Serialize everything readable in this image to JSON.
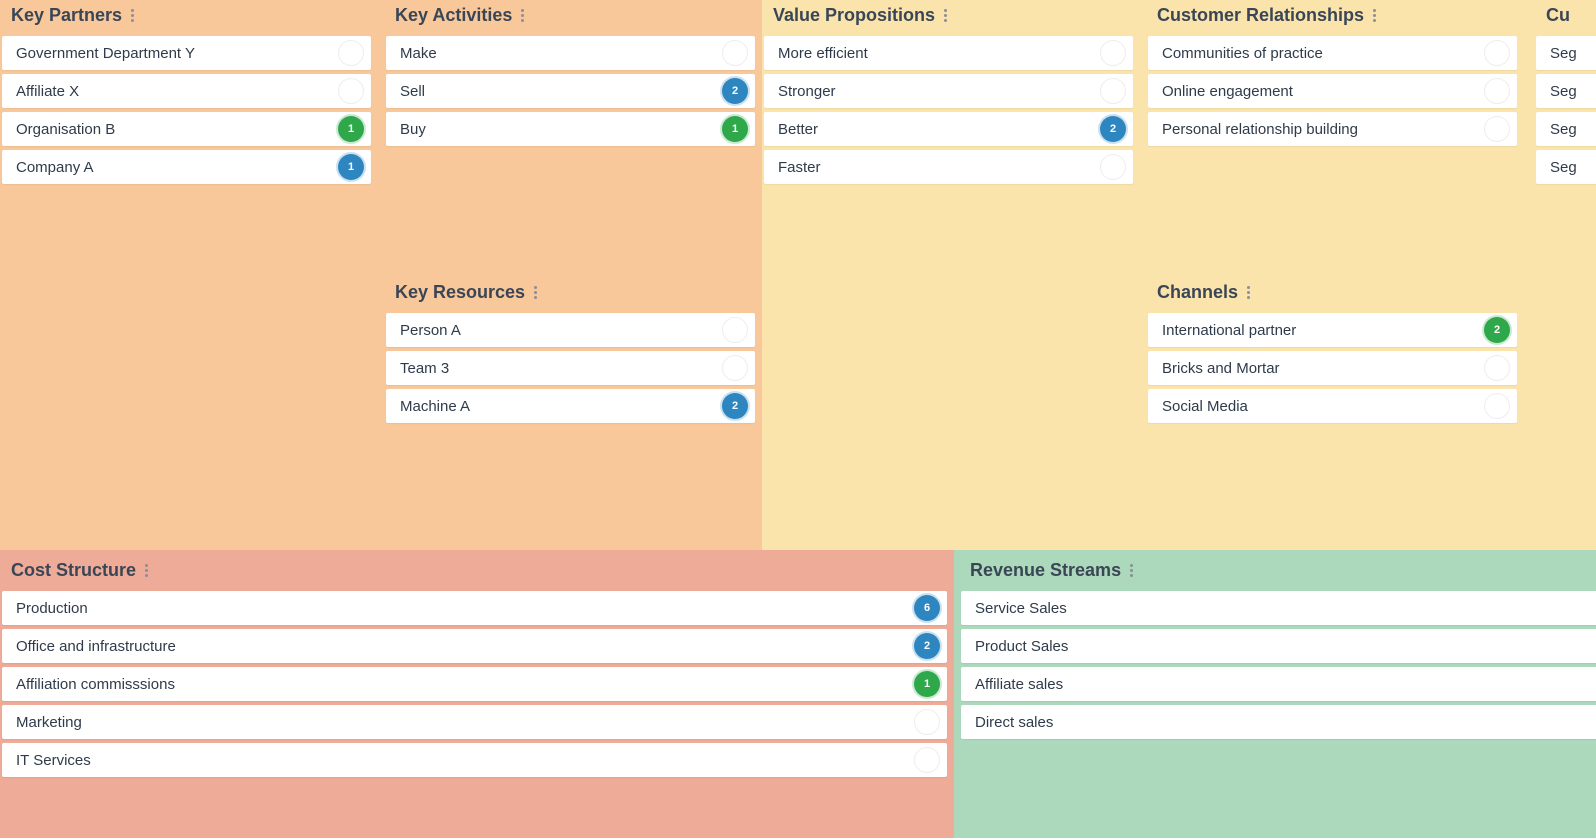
{
  "key_partners": {
    "title": "Key Partners",
    "items": [
      {
        "label": "Government Department Y",
        "badge": ""
      },
      {
        "label": "Affiliate X",
        "badge": ""
      },
      {
        "label": "Organisation B",
        "badge": "1",
        "badge_color": "green"
      },
      {
        "label": "Company A",
        "badge": "1",
        "badge_color": "blue"
      }
    ]
  },
  "key_activities": {
    "title": "Key Activities",
    "items": [
      {
        "label": "Make",
        "badge": ""
      },
      {
        "label": "Sell",
        "badge": "2",
        "badge_color": "blue"
      },
      {
        "label": "Buy",
        "badge": "1",
        "badge_color": "green"
      }
    ]
  },
  "key_resources": {
    "title": "Key Resources",
    "items": [
      {
        "label": "Person A",
        "badge": ""
      },
      {
        "label": "Team 3",
        "badge": ""
      },
      {
        "label": "Machine A",
        "badge": "2",
        "badge_color": "blue"
      }
    ]
  },
  "value_propositions": {
    "title": "Value Propositions",
    "items": [
      {
        "label": "More efficient",
        "badge": ""
      },
      {
        "label": "Stronger",
        "badge": ""
      },
      {
        "label": "Better",
        "badge": "2",
        "badge_color": "blue"
      },
      {
        "label": "Faster",
        "badge": ""
      }
    ]
  },
  "customer_relationships": {
    "title": "Customer Relationships",
    "items": [
      {
        "label": "Communities of practice",
        "badge": ""
      },
      {
        "label": "Online engagement",
        "badge": ""
      },
      {
        "label": "Personal relationship building",
        "badge": ""
      }
    ]
  },
  "channels": {
    "title": "Channels",
    "items": [
      {
        "label": "International partner",
        "badge": "2",
        "badge_color": "green"
      },
      {
        "label": "Bricks and Mortar",
        "badge": ""
      },
      {
        "label": "Social Media",
        "badge": ""
      }
    ]
  },
  "customer_segments": {
    "title": "Cu",
    "items": [
      {
        "label": "Seg"
      },
      {
        "label": "Seg"
      },
      {
        "label": "Seg"
      },
      {
        "label": "Seg"
      }
    ]
  },
  "cost_structure": {
    "title": "Cost Structure",
    "items": [
      {
        "label": "Production",
        "badge": "6",
        "badge_color": "blue"
      },
      {
        "label": "Office and infrastructure",
        "badge": "2",
        "badge_color": "blue"
      },
      {
        "label": "Affiliation commisssions",
        "badge": "1",
        "badge_color": "green"
      },
      {
        "label": "Marketing",
        "badge": ""
      },
      {
        "label": "IT Services",
        "badge": ""
      }
    ]
  },
  "revenue_streams": {
    "title": "Revenue Streams",
    "items": [
      {
        "label": "Service Sales"
      },
      {
        "label": "Product Sales"
      },
      {
        "label": "Affiliate sales"
      },
      {
        "label": "Direct sales"
      }
    ]
  },
  "colors": {
    "partners_bg": "#f8c89a",
    "value_bg": "#fbe3ac",
    "cost_bg": "#eeab97",
    "revenue_bg": "#acd8bb",
    "badge_blue": "#2e86c1",
    "badge_green": "#2ea84a",
    "title_text": "#3a4656"
  }
}
